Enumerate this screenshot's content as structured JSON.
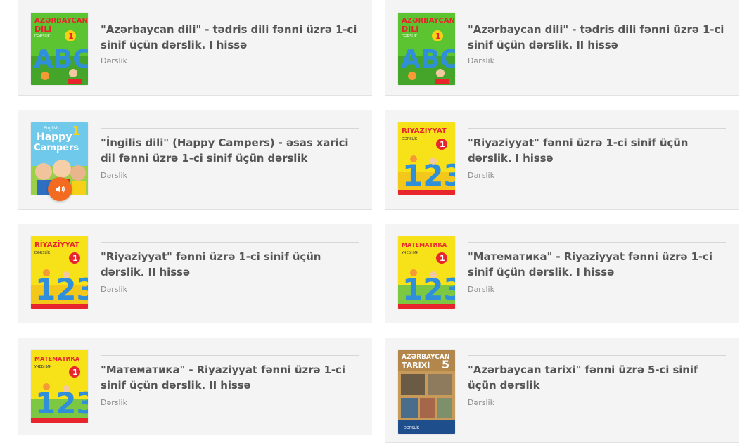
{
  "books": [
    {
      "title": "\"Azərbaycan dili\" - tədris dili fənni üzrə 1-ci sinif üçün dərslik. I hissə",
      "type": "Dərslik",
      "cover": "azdili"
    },
    {
      "title": "\"Azərbaycan dili\" - tədris dili fənni üzrə 1-ci sinif üçün dərslik. II hissə",
      "type": "Dərslik",
      "cover": "azdili"
    },
    {
      "title": "\"İngilis dili\" (Happy Campers) - əsas xarici dil fənni üzrə 1-ci sinif üçün dərslik",
      "type": "Dərslik",
      "cover": "happy",
      "audio": true
    },
    {
      "title": "\"Riyaziyyat\" fənni üzrə 1-ci sinif üçün dərslik. I hissə",
      "type": "Dərslik",
      "cover": "riyaziyyat"
    },
    {
      "title": "\"Riyaziyyat\" fənni üzrə 1-ci sinif üçün dərslik. II hissə",
      "type": "Dərslik",
      "cover": "riyaziyyat"
    },
    {
      "title": "\"Математика\" - Riyaziyyat fənni üzrə 1-ci sinif üçün dərslik. I hissə",
      "type": "Dərslik",
      "cover": "matematika"
    },
    {
      "title": "\"Математика\" - Riyaziyyat fənni üzrə 1-ci sinif üçün dərslik. II hissə",
      "type": "Dərslik",
      "cover": "matematika"
    },
    {
      "title": "\"Azərbaycan tarixi\" fənni üzrə 5-ci sinif üçün dərslik",
      "type": "Dərslik",
      "cover": "tarix"
    }
  ],
  "covers": {
    "azdili": {
      "line1": "AZƏRBAYCAN",
      "line2": "DİLİ",
      "grade": "1",
      "sub": "DƏRSLİK",
      "letters": "ABC"
    },
    "happy": {
      "brand": "English",
      "line1": "Happy",
      "line2": "Campers",
      "grade": "1"
    },
    "riyaziyyat": {
      "line1": "RİYAZİYYAT",
      "sub": "DƏRSLİK",
      "grade": "1",
      "digits": "123"
    },
    "matematika": {
      "line1": "МАТЕМАТИКА",
      "sub": "УЧЕБНИК",
      "grade": "1",
      "digits": "123"
    },
    "tarix": {
      "line1": "AZƏRBAYCAN",
      "line2": "TARİXİ",
      "grade": "5",
      "sub": "DƏRSLİK"
    }
  },
  "icons": {
    "audio": "speaker-icon"
  },
  "colors": {
    "accent": "#f26b21",
    "card_bg": "#f4f4f4",
    "title": "#555555",
    "meta": "#8a8a8a"
  }
}
